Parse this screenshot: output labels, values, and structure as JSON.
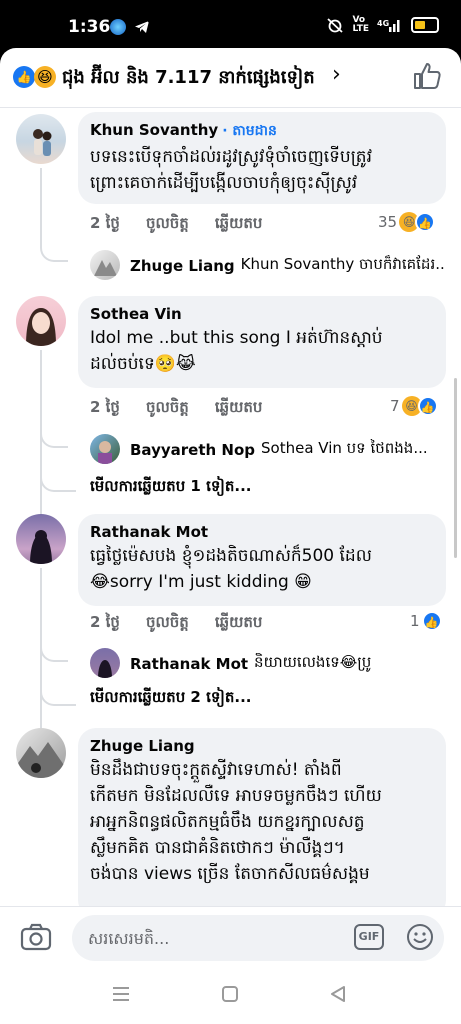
{
  "status": {
    "time": "1:36",
    "signal_text": "Vo LTE 4G"
  },
  "reactions_header": {
    "text": "ជុង អ៊ីល និង 7.117 នាក់ផ្សេងទៀត",
    "chevron": "›"
  },
  "comments": [
    {
      "name": "Khun Sovanthy",
      "follow": "· តាមដាន",
      "body": "បទនេះបើទុកចាំដល់រដូវស្រូវទុំចាំចេញទើបត្រូវ\nព្រោះគេចាក់ដើម្បីបង្កើលចាបកុំឲ្យចុះស៊ីស្រូវ",
      "time": "2 ថ្ងៃ",
      "like": "ចូលចិត្ត",
      "reply": "ឆ្លើយតប",
      "count": "35",
      "reply_preview": {
        "name": "Zhuge Liang",
        "text": "Khun Sovanthy ចាបក៏វាគេដែរ..."
      }
    },
    {
      "name": "Sothea Vin",
      "body": "Idol me ..but this song I អត់ហ៊ានស្ដាប់\nដល់ចប់ទេ🥺😹",
      "time": "2 ថ្ងៃ",
      "like": "ចូលចិត្ត",
      "reply": "ឆ្លើយតប",
      "count": "7",
      "reply_preview": {
        "name": "Bayyareth Nop",
        "text": "Sothea Vin បទ ថៃពងង..."
      },
      "more": "មើលការឆ្លើយតប 1 ទៀត..."
    },
    {
      "name": "Rathanak Mot",
      "body": "ធ្វេថ្លៃម៉េសបង ខ្ញុំ១ដងតិចណាស់ក៏500 ដែល\n😂sorry I'm just kidding 😁",
      "time": "2 ថ្ងៃ",
      "like": "ចូលចិត្ត",
      "reply": "ឆ្លើយតប",
      "count": "1",
      "reply_preview": {
        "name": "Rathanak Mot",
        "text": "និយាយលេងទេ😂ប្រូ"
      },
      "more": "មើលការឆ្លើយតប 2 ទៀត..."
    },
    {
      "name": "Zhuge Liang",
      "body": "មិនដឹងជាបទចុះក្ដួតស្ទីវាទេហាស់! តាំងពី\nកើតមក មិនដែលលឺទេ អាបទចម្លកចឹងៗ ហើយ\nអាអ្នកនិពន្ធផលិតកម្មធំចឹង យកខ្នរក្បាលសត្វ\nស្លឹមកគិត បានជាគំនិតថោកៗ ម៉ាលឺង្គៗ។\nចង់បាន views ច្រើន តែចាកសីលធម៌សង្គម"
    }
  ],
  "composer": {
    "placeholder": "សរសេរមតិ...",
    "gif": "GIF"
  },
  "colors": {
    "accent": "#1877f2",
    "bubble": "#f0f2f5",
    "meta": "#65676b"
  }
}
